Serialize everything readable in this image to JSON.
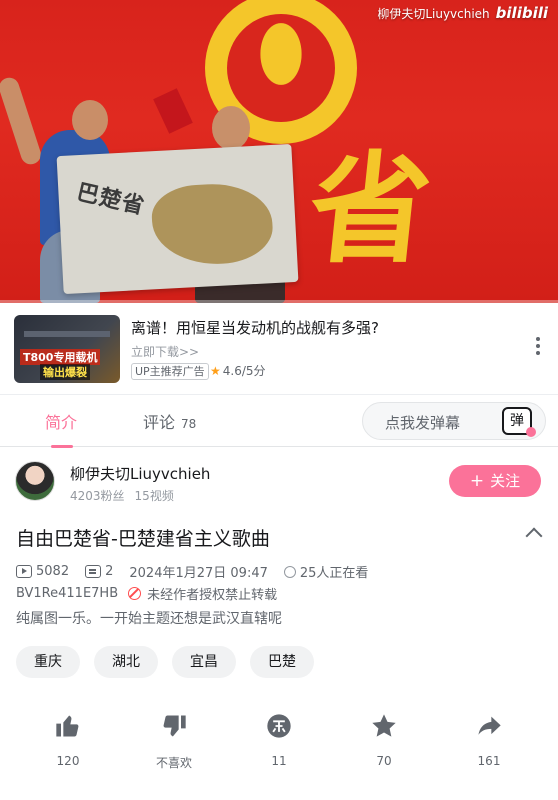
{
  "video": {
    "watermark_user": "柳伊夫切Liuyvchieh",
    "watermark_brand": "bilibili",
    "banner_text": "巴楚省",
    "background_char": "省"
  },
  "ad": {
    "title": "离谱！用恒星当发动机的战舰有多强?",
    "subtitle": "立即下载>>",
    "tag": "UP主推荐广告",
    "rating": "4.6/5分",
    "thumb_text_1": "T800专用载机",
    "thumb_text_2": "输出爆裂"
  },
  "tabs": {
    "intro": "简介",
    "comments": "评论",
    "comments_count": "78",
    "danmu_placeholder": "点我发弹幕",
    "danmu_toggle": "弹"
  },
  "uploader": {
    "name": "柳伊夫切Liuyvchieh",
    "fans": "4203粉丝",
    "videos": "15视频",
    "follow": "关注"
  },
  "info": {
    "title": "自由巴楚省-巴楚建省主义歌曲",
    "views": "5082",
    "danmaku": "2",
    "date": "2024年1月27日 09:47",
    "watching": "25人正在看",
    "bvid": "BV1Re411E7HB",
    "copyright": "未经作者授权禁止转载",
    "description": "纯属图一乐。一开始主题还想是武汉直辖呢"
  },
  "tags": [
    "重庆",
    "湖北",
    "宜昌",
    "巴楚"
  ],
  "actions": [
    {
      "icon": "thumbs-up-icon",
      "label": "120"
    },
    {
      "icon": "thumbs-down-icon",
      "label": "不喜欢"
    },
    {
      "icon": "coin-icon",
      "label": "11"
    },
    {
      "icon": "star-icon",
      "label": "70"
    },
    {
      "icon": "share-icon",
      "label": "161"
    }
  ],
  "colors": {
    "accent": "#fb7299",
    "text_primary": "#18191c",
    "text_secondary": "#61666d",
    "rating_star": "#ff9f1a",
    "forbidden": "#ff4d4f"
  }
}
